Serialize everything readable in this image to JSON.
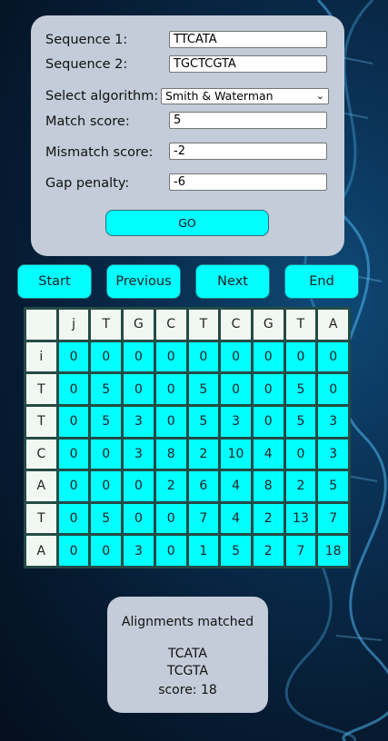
{
  "form": {
    "seq1_label": "Sequence 1:",
    "seq1_value": "TTCATA",
    "seq2_label": "Sequence 2:",
    "seq2_value": "TGCTCGTA",
    "algorithm_label": "Select algorithm:",
    "algorithm_value": "Smith & Waterman",
    "match_label": "Match score:",
    "match_value": "5",
    "mismatch_label": "Mismatch score:",
    "mismatch_value": "-2",
    "gap_label": "Gap penalty:",
    "gap_value": "-6",
    "go_label": "GO"
  },
  "nav": {
    "start": "Start",
    "previous": "Previous",
    "next": "Next",
    "end": "End"
  },
  "matrix": {
    "col_headers": [
      "",
      "j",
      "T",
      "G",
      "C",
      "T",
      "C",
      "G",
      "T",
      "A"
    ],
    "row_headers": [
      "i",
      "T",
      "T",
      "C",
      "A",
      "T",
      "A"
    ],
    "rows": [
      [
        "0",
        "0",
        "0",
        "0",
        "0",
        "0",
        "0",
        "0",
        "0"
      ],
      [
        "0",
        "5",
        "0",
        "0",
        "5",
        "0",
        "0",
        "5",
        "0"
      ],
      [
        "0",
        "5",
        "3",
        "0",
        "5",
        "3",
        "0",
        "5",
        "3"
      ],
      [
        "0",
        "0",
        "3",
        "8",
        "2",
        "10",
        "4",
        "0",
        "3"
      ],
      [
        "0",
        "0",
        "0",
        "2",
        "6",
        "4",
        "8",
        "2",
        "5"
      ],
      [
        "0",
        "5",
        "0",
        "0",
        "7",
        "4",
        "2",
        "13",
        "7"
      ],
      [
        "0",
        "0",
        "3",
        "0",
        "1",
        "5",
        "2",
        "7",
        "18"
      ]
    ]
  },
  "result": {
    "title": "Alignments matched",
    "line1": "TCATA",
    "line2": "TCGTA",
    "score": "score: 18"
  },
  "colors": {
    "accent": "#00ffff",
    "panel": "#c3ccd8",
    "grid_border": "#234b45"
  }
}
